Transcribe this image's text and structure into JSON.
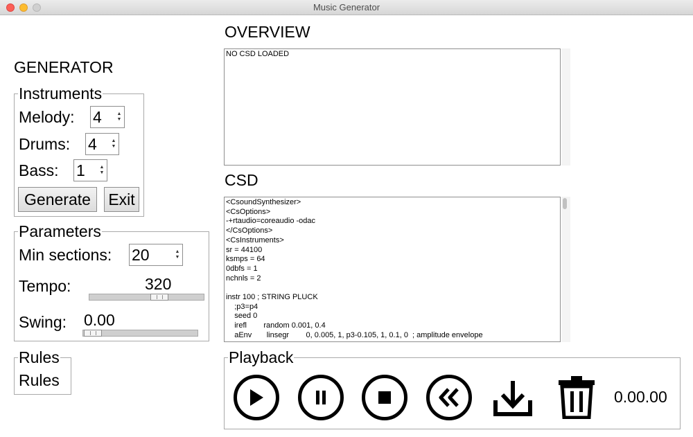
{
  "window": {
    "title": "Music Generator"
  },
  "generator": {
    "heading": "GENERATOR",
    "instruments": {
      "legend": "Instruments",
      "melody_label": "Melody:",
      "melody_value": "4",
      "drums_label": "Drums:",
      "drums_value": "4",
      "bass_label": "Bass:",
      "bass_value": "1",
      "generate_label": "Generate",
      "exit_label": "Exit"
    },
    "parameters": {
      "legend": "Parameters",
      "min_sections_label": "Min sections:",
      "min_sections_value": "20",
      "tempo_label": "Tempo:",
      "tempo_value": "320",
      "swing_label": "Swing:",
      "swing_value": "0.00"
    },
    "rules": {
      "legend": "Rules",
      "button_label": "Rules"
    }
  },
  "overview": {
    "heading": "OVERVIEW",
    "text": "NO CSD LOADED"
  },
  "csd": {
    "heading": "CSD",
    "text": "<CsoundSynthesizer>\n<CsOptions>\n-+rtaudio=coreaudio -odac\n</CsOptions>\n<CsInstruments>\nsr = 44100\nksmps = 64\n0dbfs = 1\nnchnls = 2\n\ninstr 100 ; STRING PLUCK\n    ;p3=p4\n    seed 0\n    irefl        random 0.001, 0.4\n    aEnv       linsegr        0, 0.005, 1, p3-0.105, 1, 0.1, 0  ; amplitude envelope"
  },
  "playback": {
    "legend": "Playback",
    "time": "0.00.00",
    "icons": [
      "play-icon",
      "pause-icon",
      "stop-icon",
      "rewind-icon",
      "download-icon",
      "trash-icon"
    ]
  }
}
